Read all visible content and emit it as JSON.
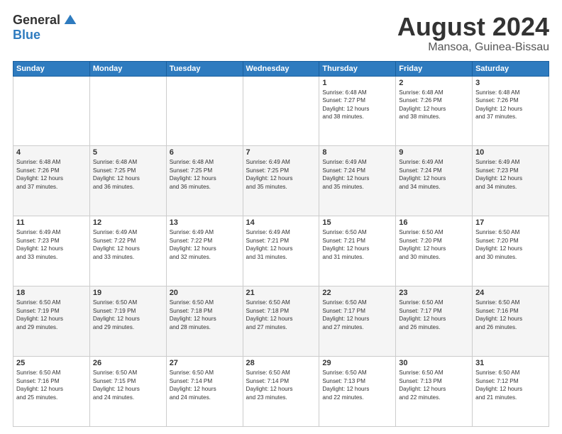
{
  "header": {
    "logo_general": "General",
    "logo_blue": "Blue",
    "month_year": "August 2024",
    "location": "Mansoa, Guinea-Bissau"
  },
  "weekdays": [
    "Sunday",
    "Monday",
    "Tuesday",
    "Wednesday",
    "Thursday",
    "Friday",
    "Saturday"
  ],
  "weeks": [
    [
      {
        "day": "",
        "info": ""
      },
      {
        "day": "",
        "info": ""
      },
      {
        "day": "",
        "info": ""
      },
      {
        "day": "",
        "info": ""
      },
      {
        "day": "1",
        "info": "Sunrise: 6:48 AM\nSunset: 7:27 PM\nDaylight: 12 hours\nand 38 minutes."
      },
      {
        "day": "2",
        "info": "Sunrise: 6:48 AM\nSunset: 7:26 PM\nDaylight: 12 hours\nand 38 minutes."
      },
      {
        "day": "3",
        "info": "Sunrise: 6:48 AM\nSunset: 7:26 PM\nDaylight: 12 hours\nand 37 minutes."
      }
    ],
    [
      {
        "day": "4",
        "info": "Sunrise: 6:48 AM\nSunset: 7:26 PM\nDaylight: 12 hours\nand 37 minutes."
      },
      {
        "day": "5",
        "info": "Sunrise: 6:48 AM\nSunset: 7:25 PM\nDaylight: 12 hours\nand 36 minutes."
      },
      {
        "day": "6",
        "info": "Sunrise: 6:48 AM\nSunset: 7:25 PM\nDaylight: 12 hours\nand 36 minutes."
      },
      {
        "day": "7",
        "info": "Sunrise: 6:49 AM\nSunset: 7:25 PM\nDaylight: 12 hours\nand 35 minutes."
      },
      {
        "day": "8",
        "info": "Sunrise: 6:49 AM\nSunset: 7:24 PM\nDaylight: 12 hours\nand 35 minutes."
      },
      {
        "day": "9",
        "info": "Sunrise: 6:49 AM\nSunset: 7:24 PM\nDaylight: 12 hours\nand 34 minutes."
      },
      {
        "day": "10",
        "info": "Sunrise: 6:49 AM\nSunset: 7:23 PM\nDaylight: 12 hours\nand 34 minutes."
      }
    ],
    [
      {
        "day": "11",
        "info": "Sunrise: 6:49 AM\nSunset: 7:23 PM\nDaylight: 12 hours\nand 33 minutes."
      },
      {
        "day": "12",
        "info": "Sunrise: 6:49 AM\nSunset: 7:22 PM\nDaylight: 12 hours\nand 33 minutes."
      },
      {
        "day": "13",
        "info": "Sunrise: 6:49 AM\nSunset: 7:22 PM\nDaylight: 12 hours\nand 32 minutes."
      },
      {
        "day": "14",
        "info": "Sunrise: 6:49 AM\nSunset: 7:21 PM\nDaylight: 12 hours\nand 31 minutes."
      },
      {
        "day": "15",
        "info": "Sunrise: 6:50 AM\nSunset: 7:21 PM\nDaylight: 12 hours\nand 31 minutes."
      },
      {
        "day": "16",
        "info": "Sunrise: 6:50 AM\nSunset: 7:20 PM\nDaylight: 12 hours\nand 30 minutes."
      },
      {
        "day": "17",
        "info": "Sunrise: 6:50 AM\nSunset: 7:20 PM\nDaylight: 12 hours\nand 30 minutes."
      }
    ],
    [
      {
        "day": "18",
        "info": "Sunrise: 6:50 AM\nSunset: 7:19 PM\nDaylight: 12 hours\nand 29 minutes."
      },
      {
        "day": "19",
        "info": "Sunrise: 6:50 AM\nSunset: 7:19 PM\nDaylight: 12 hours\nand 29 minutes."
      },
      {
        "day": "20",
        "info": "Sunrise: 6:50 AM\nSunset: 7:18 PM\nDaylight: 12 hours\nand 28 minutes."
      },
      {
        "day": "21",
        "info": "Sunrise: 6:50 AM\nSunset: 7:18 PM\nDaylight: 12 hours\nand 27 minutes."
      },
      {
        "day": "22",
        "info": "Sunrise: 6:50 AM\nSunset: 7:17 PM\nDaylight: 12 hours\nand 27 minutes."
      },
      {
        "day": "23",
        "info": "Sunrise: 6:50 AM\nSunset: 7:17 PM\nDaylight: 12 hours\nand 26 minutes."
      },
      {
        "day": "24",
        "info": "Sunrise: 6:50 AM\nSunset: 7:16 PM\nDaylight: 12 hours\nand 26 minutes."
      }
    ],
    [
      {
        "day": "25",
        "info": "Sunrise: 6:50 AM\nSunset: 7:16 PM\nDaylight: 12 hours\nand 25 minutes."
      },
      {
        "day": "26",
        "info": "Sunrise: 6:50 AM\nSunset: 7:15 PM\nDaylight: 12 hours\nand 24 minutes."
      },
      {
        "day": "27",
        "info": "Sunrise: 6:50 AM\nSunset: 7:14 PM\nDaylight: 12 hours\nand 24 minutes."
      },
      {
        "day": "28",
        "info": "Sunrise: 6:50 AM\nSunset: 7:14 PM\nDaylight: 12 hours\nand 23 minutes."
      },
      {
        "day": "29",
        "info": "Sunrise: 6:50 AM\nSunset: 7:13 PM\nDaylight: 12 hours\nand 22 minutes."
      },
      {
        "day": "30",
        "info": "Sunrise: 6:50 AM\nSunset: 7:13 PM\nDaylight: 12 hours\nand 22 minutes."
      },
      {
        "day": "31",
        "info": "Sunrise: 6:50 AM\nSunset: 7:12 PM\nDaylight: 12 hours\nand 21 minutes."
      }
    ]
  ]
}
